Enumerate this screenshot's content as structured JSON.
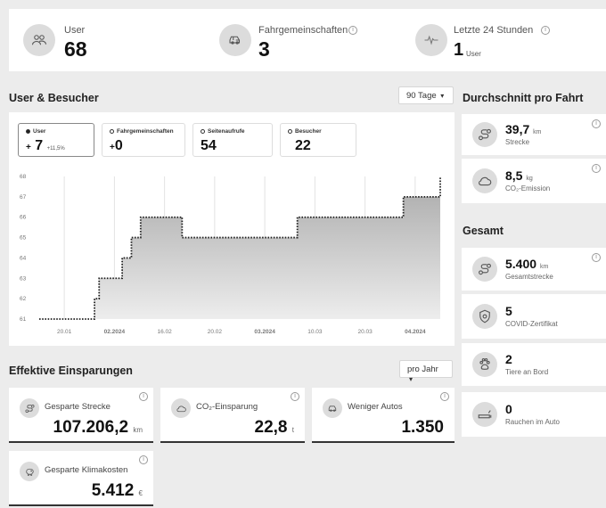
{
  "stats": [
    {
      "label": "User",
      "value": "68",
      "sub": "",
      "icon": "users-icon"
    },
    {
      "label": "Fahrgemeinschaften",
      "value": "3",
      "sub": "",
      "icon": "car-icon"
    },
    {
      "label": "Letzte 24 Stunden",
      "value": "1",
      "sub": "User",
      "icon": "activity-icon"
    }
  ],
  "users_section": {
    "title": "User & Besucher",
    "period": "90 Tage",
    "tabs": [
      {
        "label": "User",
        "prefix": "+",
        "value": "7",
        "change": "+11,5%"
      },
      {
        "label": "Fahrgemeinschaften",
        "prefix": "+",
        "value": "0",
        "change": ""
      },
      {
        "label": "Seitenaufrufe",
        "prefix": "",
        "value": "54",
        "change": ""
      },
      {
        "label": "Besucher",
        "prefix": "",
        "value": "22",
        "change": ""
      }
    ]
  },
  "chart_data": {
    "type": "area",
    "y_ticks": [
      "68",
      "67",
      "66",
      "65",
      "64",
      "63",
      "62",
      "61"
    ],
    "x_ticks": [
      "20.01",
      "02.2024",
      "16.02",
      "20.02",
      "03.2024",
      "10.03",
      "20.03",
      "04.2024"
    ],
    "x_ticks_bold": [
      false,
      true,
      false,
      false,
      true,
      false,
      false,
      true
    ],
    "ylim": [
      61,
      68
    ],
    "series": [
      {
        "values": [
          61,
          61,
          61,
          61,
          61,
          61,
          61,
          61,
          61,
          61,
          61,
          61,
          62,
          63,
          63,
          63,
          63,
          63,
          64,
          64,
          65,
          65,
          66,
          66,
          66,
          66,
          66,
          66,
          66,
          66,
          66,
          65,
          65,
          65,
          65,
          65,
          65,
          65,
          65,
          65,
          65,
          65,
          65,
          65,
          65,
          65,
          65,
          65,
          65,
          65,
          65,
          65,
          65,
          65,
          65,
          65,
          66,
          66,
          66,
          66,
          66,
          66,
          66,
          66,
          66,
          66,
          66,
          66,
          66,
          66,
          66,
          66,
          66,
          66,
          66,
          66,
          66,
          66,
          66,
          67,
          67,
          67,
          67,
          67,
          67,
          67,
          67,
          68
        ]
      }
    ],
    "grid": true
  },
  "avg_section": {
    "title": "Durchschnitt pro Fahrt",
    "items": [
      {
        "value": "39,7",
        "unit": "km",
        "label": "Strecke",
        "icon": "route-icon"
      },
      {
        "value": "8,5",
        "unit": "kg",
        "label": "CO₂-Emission",
        "icon": "cloud-icon"
      }
    ]
  },
  "total_section": {
    "title": "Gesamt",
    "items": [
      {
        "value": "5.400",
        "unit": "km",
        "label": "Gesamtstrecke",
        "icon": "route-icon"
      },
      {
        "value": "5",
        "unit": "",
        "label": "COVID-Zertifikat",
        "icon": "shield-icon"
      },
      {
        "value": "2",
        "unit": "",
        "label": "Tiere an Bord",
        "icon": "paw-icon"
      },
      {
        "value": "0",
        "unit": "",
        "label": "Rauchen im Auto",
        "icon": "cigarette-icon"
      }
    ]
  },
  "savings_section": {
    "title": "Effektive Einsparungen",
    "period": "pro Jahr",
    "items": [
      {
        "label": "Gesparte Strecke",
        "value": "107.206,2",
        "unit": "km",
        "icon": "route-icon"
      },
      {
        "label": "CO₂-Einsparung",
        "value": "22,8",
        "unit": "t",
        "icon": "cloud-icon"
      },
      {
        "label": "Weniger Autos",
        "value": "1.350",
        "unit": "",
        "icon": "car-icon"
      },
      {
        "label": "Gesparte Klimakosten",
        "value": "5.412",
        "unit": "€",
        "icon": "piggy-bank-icon"
      }
    ]
  },
  "info_glyph": "i",
  "dropdown_glyph": "▾"
}
